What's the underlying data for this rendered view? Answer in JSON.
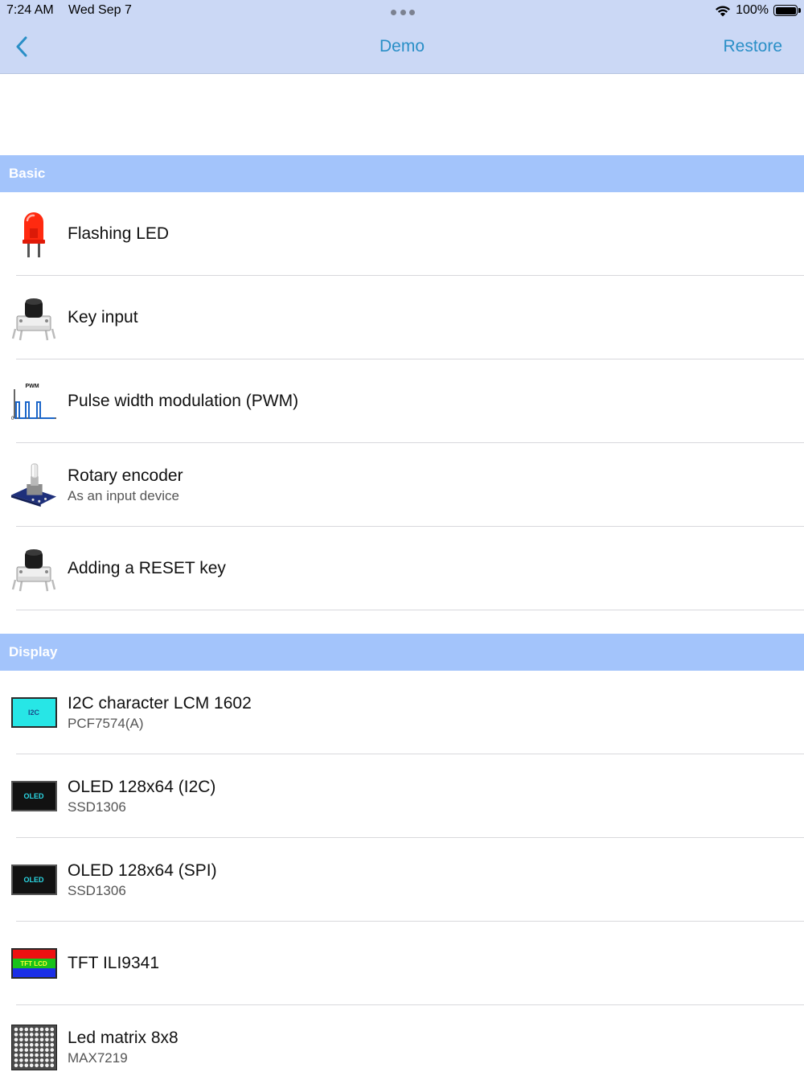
{
  "status_bar": {
    "time": "7:24 AM",
    "date": "Wed Sep 7",
    "battery": "100%"
  },
  "nav": {
    "title": "Demo",
    "restore_label": "Restore"
  },
  "sections": [
    {
      "header": "Basic",
      "items": [
        {
          "title": "Flashing LED",
          "subtitle": "",
          "icon": "led-icon"
        },
        {
          "title": "Key input",
          "subtitle": "",
          "icon": "push-button-icon"
        },
        {
          "title": "Pulse width modulation (PWM)",
          "subtitle": "",
          "icon": "pwm-waveform-icon"
        },
        {
          "title": "Rotary encoder",
          "subtitle": "As an input device",
          "icon": "rotary-encoder-icon"
        },
        {
          "title": "Adding a RESET key",
          "subtitle": "",
          "icon": "push-button-icon"
        }
      ]
    },
    {
      "header": "Display",
      "items": [
        {
          "title": "I2C character LCM 1602",
          "subtitle": "PCF7574(A)",
          "icon": "i2c-lcd-icon"
        },
        {
          "title": "OLED 128x64 (I2C)",
          "subtitle": "SSD1306",
          "icon": "oled-icon"
        },
        {
          "title": "OLED 128x64 (SPI)",
          "subtitle": "SSD1306",
          "icon": "oled-icon"
        },
        {
          "title": "TFT ILI9341",
          "subtitle": "",
          "icon": "tft-lcd-icon"
        },
        {
          "title": "Led matrix 8x8",
          "subtitle": "MAX7219",
          "icon": "led-matrix-icon"
        }
      ]
    }
  ],
  "icon_labels": {
    "pwm": "PWM",
    "pwm_zero": "0",
    "i2c": "I2C",
    "oled": "OLED",
    "tft": "TFT LCD"
  },
  "colors": {
    "nav_background": "#cbd8f5",
    "tint": "#2a8fc7",
    "section_header": "#a3c4fb",
    "lcd_cyan": "#27e6e6",
    "oled_text": "#2bd9e6"
  }
}
